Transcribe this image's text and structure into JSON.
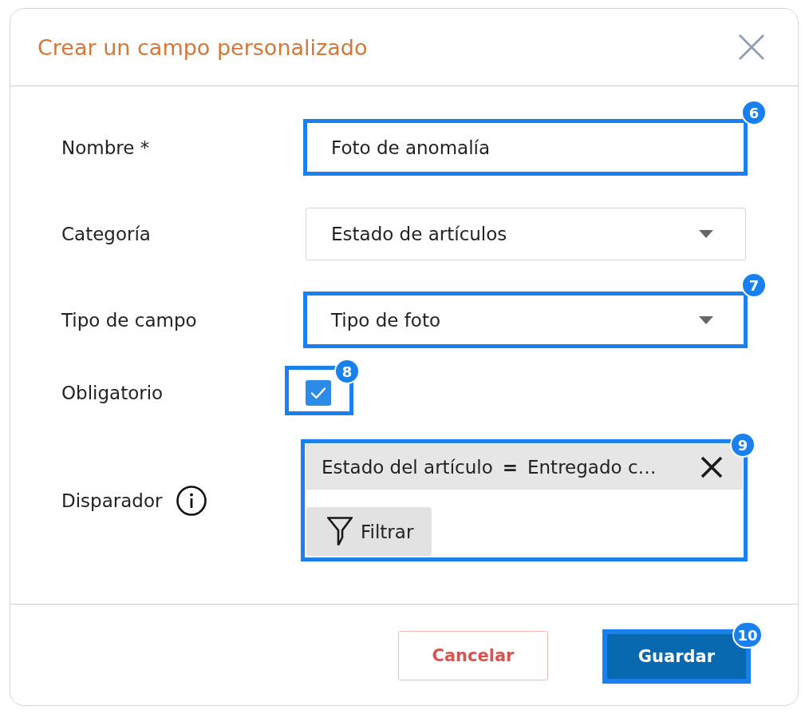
{
  "dialog": {
    "title": "Crear un campo personalizado"
  },
  "fields": [
    {
      "kind": "text",
      "label": "Nombre *",
      "value": "Foto de anomalía",
      "callout": "6"
    },
    {
      "kind": "select",
      "label": "Categoría",
      "value": "Estado de artículos"
    },
    {
      "kind": "select",
      "label": "Tipo de campo",
      "value": "Tipo de foto",
      "callout": "7"
    },
    {
      "kind": "checkbox",
      "label": "Obligatorio",
      "checked": true,
      "callout": "8"
    },
    {
      "kind": "filter",
      "label": "Disparador",
      "conditions": [
        {
          "field": "Estado del artículo",
          "operator": "=",
          "value": "Entregado c…"
        }
      ],
      "filter_button": "Filtrar",
      "callout": "9"
    }
  ],
  "buttons": [
    {
      "kind": "secondary",
      "label": "Cancelar"
    },
    {
      "kind": "primary",
      "label": "Guardar",
      "callout": "10"
    }
  ]
}
